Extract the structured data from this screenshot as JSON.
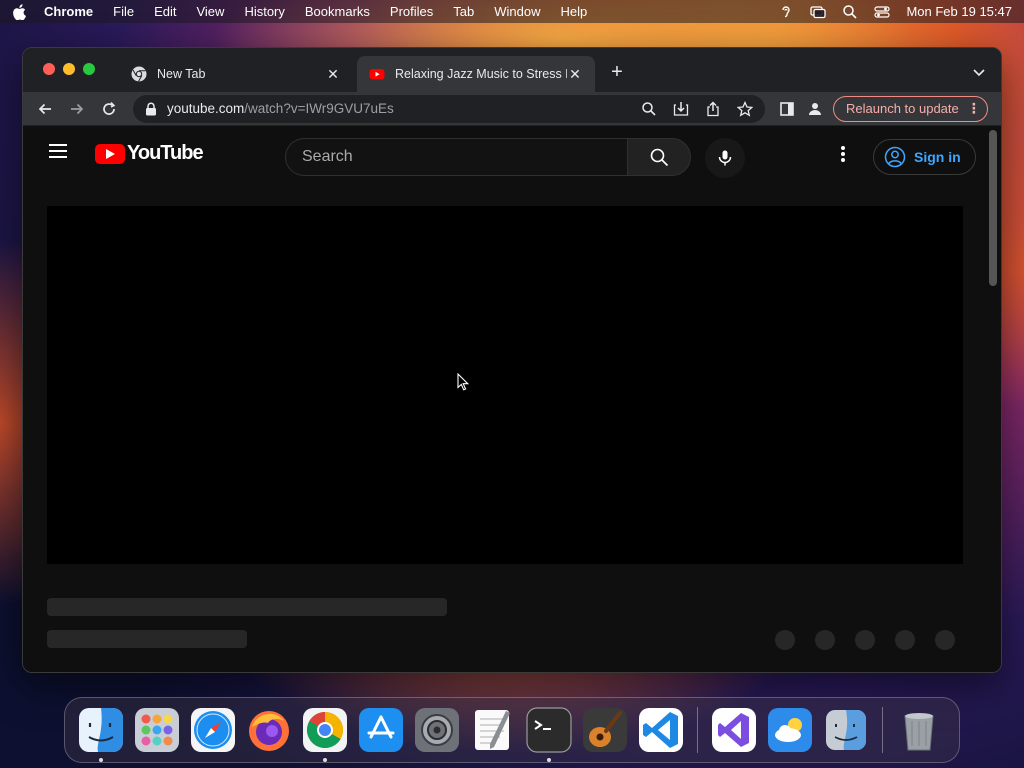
{
  "menubar": {
    "app_name": "Chrome",
    "items": [
      "File",
      "Edit",
      "View",
      "History",
      "Bookmarks",
      "Profiles",
      "Tab",
      "Window",
      "Help"
    ],
    "datetime": "Mon Feb 19  15:47",
    "status_icons": [
      "hearing-icon",
      "screen-mirroring-icon",
      "spotlight-search-icon",
      "control-center-icon"
    ]
  },
  "browser": {
    "tabs": [
      {
        "title": "New Tab",
        "favicon": "chrome-icon",
        "active": false
      },
      {
        "title": "Relaxing Jazz Music to Stress Relief",
        "favicon": "youtube-icon",
        "active": true
      }
    ],
    "url_host": "youtube.com",
    "url_path": "/watch?v=IWr9GVU7uEs",
    "relaunch_label": "Relaunch to update"
  },
  "youtube": {
    "logo_text": "YouTube",
    "search_placeholder": "Search",
    "signin_label": "Sign in"
  },
  "dock": {
    "apps": [
      "Finder",
      "Launchpad",
      "Safari",
      "Firefox",
      "Chrome",
      "App Store",
      "System Settings",
      "TextEdit",
      "Terminal",
      "GarageBand",
      "Visual Studio Code",
      "Visual Studio",
      "Weather",
      "Migration Assistant",
      "Trash"
    ]
  },
  "colors": {
    "accent_blue": "#3ea6ff",
    "youtube_red": "#ff0000",
    "relaunch_border": "#f28b82"
  }
}
